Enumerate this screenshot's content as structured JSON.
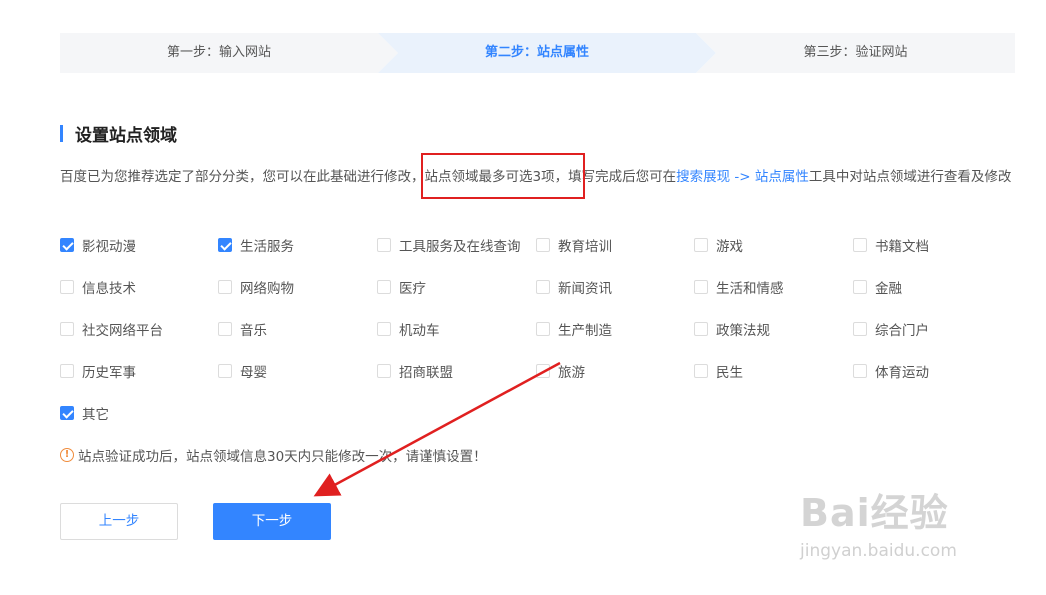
{
  "stepper": {
    "step1": "第一步：输入网站",
    "step2": "第二步：站点属性",
    "step3": "第三步：验证网站"
  },
  "section": {
    "title": "设置站点领域"
  },
  "description": {
    "part1": "百度已为您推荐选定了部分分类，您可以在此基础进行修改",
    "part2": "，站点领域最多可选3项",
    "part3": "，填写完成后您可在",
    "link1": "搜索展现",
    "arrow_text": " -> ",
    "link2": "站点属性",
    "part4": "工具中对站点领域进行查看及修改"
  },
  "categories": [
    {
      "label": "影视动漫",
      "checked": true
    },
    {
      "label": "生活服务",
      "checked": true
    },
    {
      "label": "工具服务及在线查询",
      "checked": false
    },
    {
      "label": "教育培训",
      "checked": false
    },
    {
      "label": "游戏",
      "checked": false
    },
    {
      "label": "书籍文档",
      "checked": false
    },
    {
      "label": "信息技术",
      "checked": false
    },
    {
      "label": "网络购物",
      "checked": false
    },
    {
      "label": "医疗",
      "checked": false
    },
    {
      "label": "新闻资讯",
      "checked": false
    },
    {
      "label": "生活和情感",
      "checked": false
    },
    {
      "label": "金融",
      "checked": false
    },
    {
      "label": "社交网络平台",
      "checked": false
    },
    {
      "label": "音乐",
      "checked": false
    },
    {
      "label": "机动车",
      "checked": false
    },
    {
      "label": "生产制造",
      "checked": false
    },
    {
      "label": "政策法规",
      "checked": false
    },
    {
      "label": "综合门户",
      "checked": false
    },
    {
      "label": "历史军事",
      "checked": false
    },
    {
      "label": "母婴",
      "checked": false
    },
    {
      "label": "招商联盟",
      "checked": false
    },
    {
      "label": "旅游",
      "checked": false
    },
    {
      "label": "民生",
      "checked": false
    },
    {
      "label": "体育运动",
      "checked": false
    },
    {
      "label": "其它",
      "checked": true
    }
  ],
  "warning": {
    "icon": "!",
    "text": "站点验证成功后，站点领域信息30天内只能修改一次，请谨慎设置！"
  },
  "buttons": {
    "prev": "上一步",
    "next": "下一步"
  },
  "watermark": {
    "logo": "Bai经验",
    "url": "jingyan.baidu.com"
  },
  "colors": {
    "accent": "#3385ff",
    "annotation": "#e02020",
    "warning": "#f08c3c"
  }
}
